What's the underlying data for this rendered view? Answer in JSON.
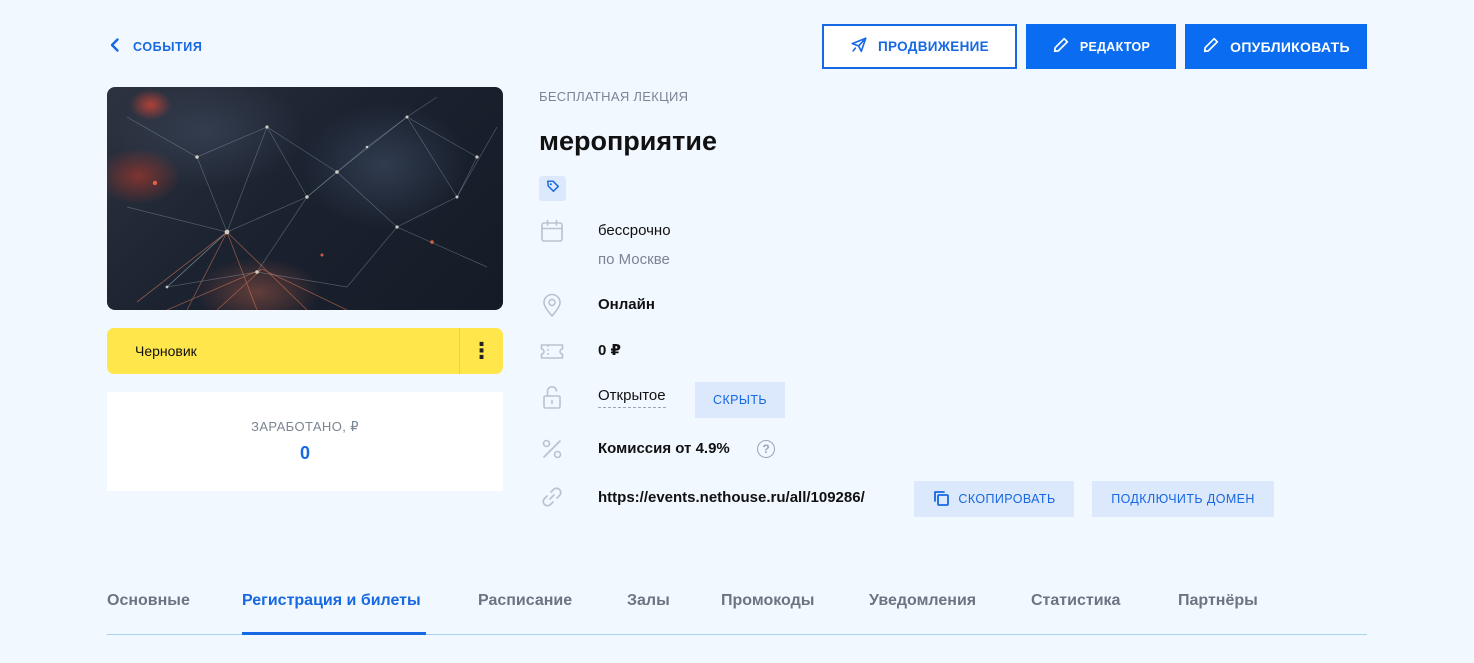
{
  "header": {
    "back_label": "СОБЫТИЯ",
    "promo_label": "ПРОДВИЖЕНИЕ",
    "edit_label": "РЕДАКТОР",
    "publish_label": "ОПУБЛИКОВАТЬ"
  },
  "event": {
    "category": "БЕСПЛАТНАЯ ЛЕКЦИЯ",
    "title": "мероприятие",
    "date": "бессрочно",
    "timezone": "по Москве",
    "location": "Онлайн",
    "price": "0 ₽",
    "access": "Открытое",
    "hide_label": "СКРЫТЬ",
    "commission": "Комиссия от 4.9%",
    "help_glyph": "?",
    "url": "https://events.nethouse.ru/all/109286/",
    "copy_label": "СКОПИРОВАТЬ",
    "domain_label": "ПОДКЛЮЧИТЬ ДОМЕН"
  },
  "status": {
    "label": "Черновик",
    "menu_glyph": "⋮",
    "color": "#ffe64b"
  },
  "earnings": {
    "label": "ЗАРАБОТАНО, ₽",
    "value": "0"
  },
  "tabs": [
    {
      "label": "Основные"
    },
    {
      "label": "Регистрация и билеты"
    },
    {
      "label": "Расписание"
    },
    {
      "label": "Залы"
    },
    {
      "label": "Промокоды"
    },
    {
      "label": "Уведомления"
    },
    {
      "label": "Статистика"
    },
    {
      "label": "Партнёры"
    }
  ],
  "active_tab": "Регистрация и билеты",
  "colors": {
    "accent": "#1668e3",
    "background": "#f2f8ff",
    "chip": "#dce8fb"
  },
  "icons": {
    "back": "chevron-left-icon",
    "promo": "paper-plane-icon",
    "edit": "pencil-icon",
    "tag": "tag-icon",
    "date": "calendar-icon",
    "location": "location-pin-icon",
    "price": "ticket-icon",
    "access": "unlock-icon",
    "commission": "percent-icon",
    "link": "link-icon",
    "copy": "copy-icon"
  }
}
